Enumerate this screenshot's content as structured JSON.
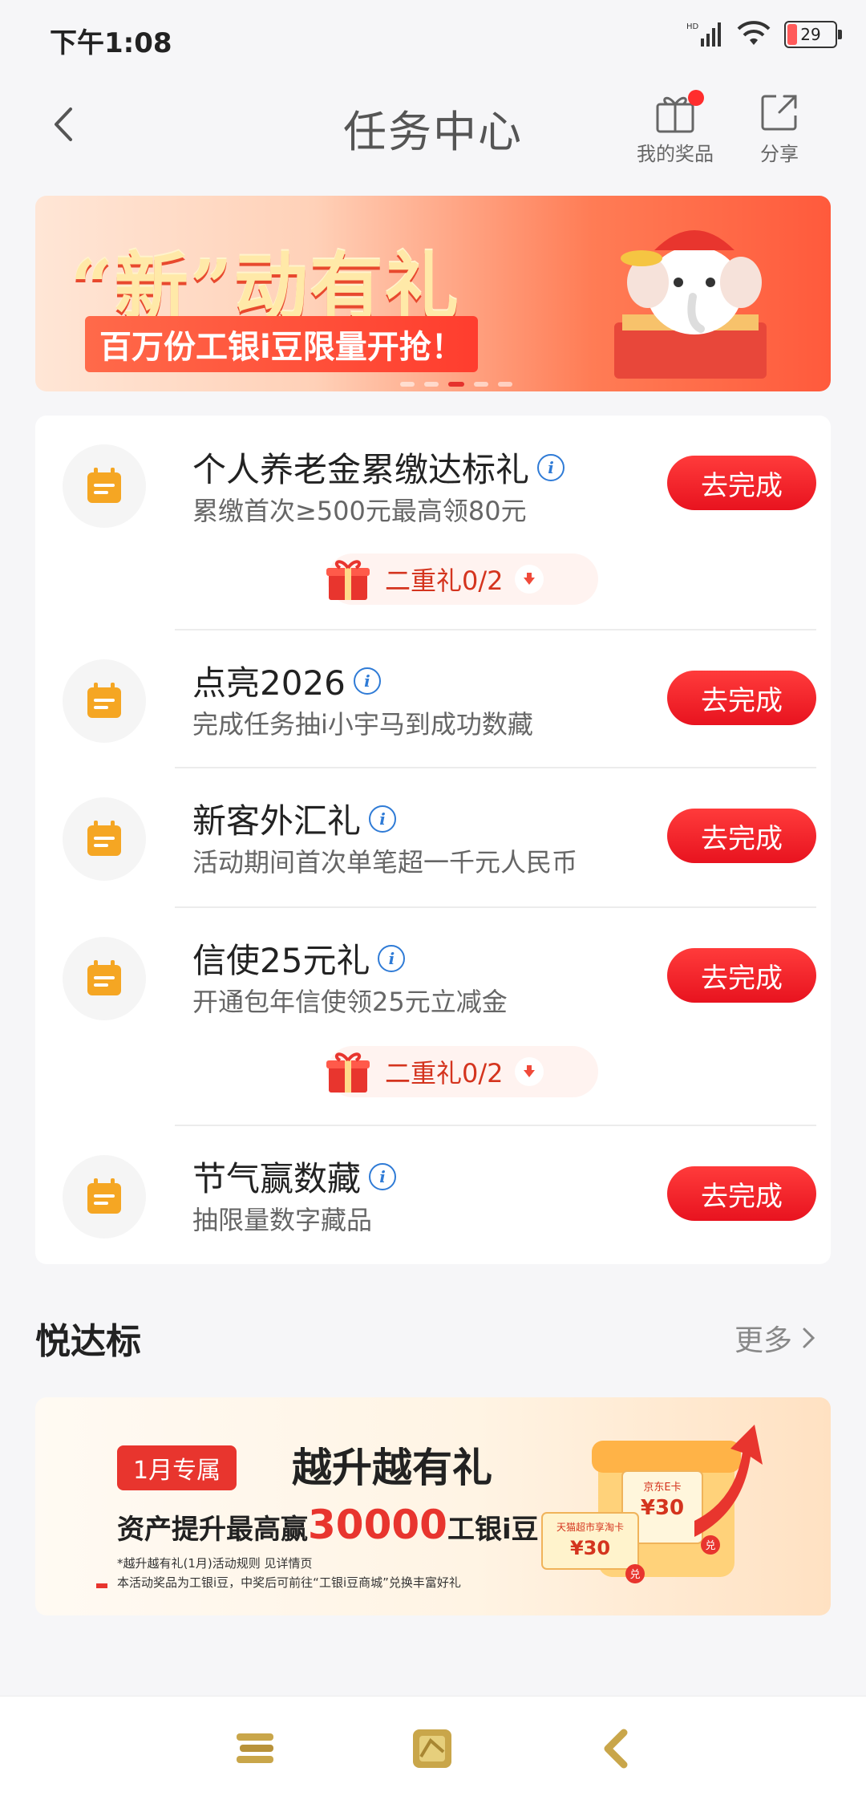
{
  "status_bar": {
    "time": "下午1:08",
    "signal": "HD",
    "battery": "29"
  },
  "header": {
    "title": "任务中心",
    "my_prizes": "我的奖品",
    "share": "分享"
  },
  "banner": {
    "headline": "“新”动有礼",
    "subline": "百万份工银i豆限量开抢！"
  },
  "tasks": [
    {
      "title": "个人养老金累缴达标礼",
      "desc": "累缴首次≥500元最高领80元",
      "button": "去完成",
      "bonus": "二重礼0/2"
    },
    {
      "title": "点亮2026",
      "desc": "完成任务抽i小宇马到成功数藏",
      "button": "去完成"
    },
    {
      "title": "新客外汇礼",
      "desc": "活动期间首次单笔超一千元人民币",
      "button": "去完成"
    },
    {
      "title": "信使25元礼",
      "desc": "开通包年信使领25元立减金",
      "button": "去完成",
      "bonus": "二重礼0/2"
    },
    {
      "title": "节气赢数藏",
      "desc": "抽限量数字藏品",
      "button": "去完成"
    }
  ],
  "section": {
    "title": "悦达标",
    "more": "更多"
  },
  "promo": {
    "tag": "1月专属",
    "headline": "越升越有礼",
    "line2_prefix": "资产提升最高赢",
    "line2_amount": "30000",
    "line2_suffix": "工银i豆",
    "note1": "*越升越有礼(1月)活动规则 见详情页",
    "note2": "本活动奖品为工银i豆，中奖后可前往“工银i豆商城”兑换丰富好礼",
    "card1": "京东E卡",
    "card1_value": "¥30",
    "card2": "天猫超市享淘卡",
    "card2_value": "¥30",
    "redeem": "兑"
  },
  "colors": {
    "accent": "#e8131f",
    "icon_orange": "#f5a623",
    "info_blue": "#2f7bd6"
  }
}
